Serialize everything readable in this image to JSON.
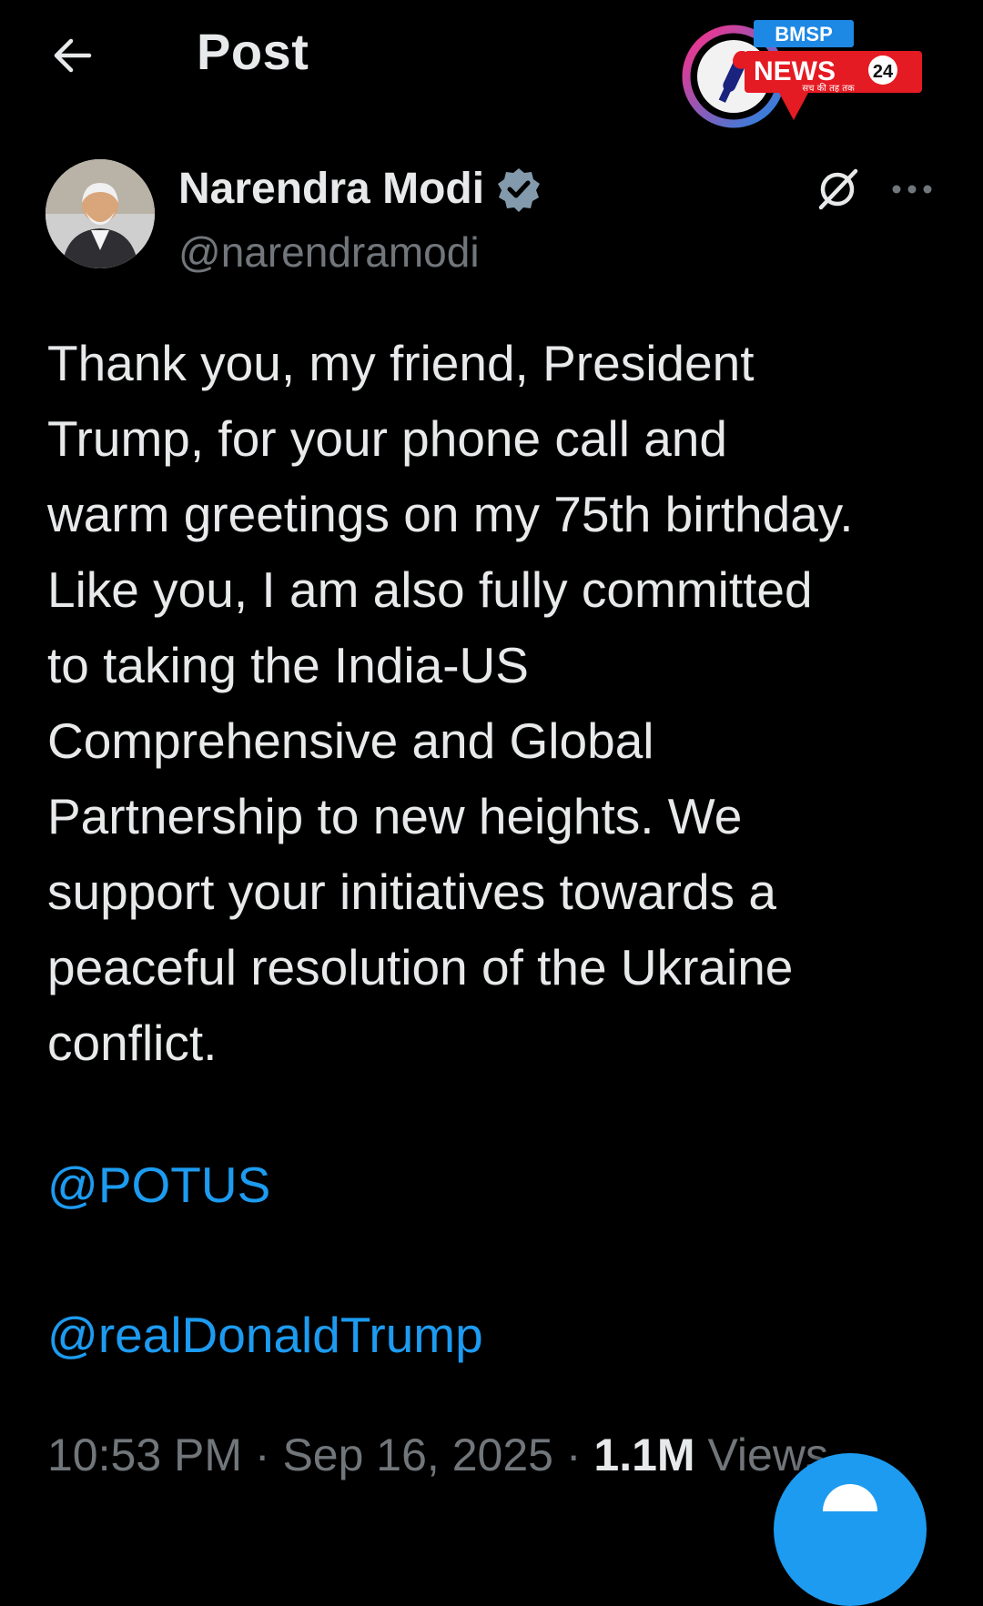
{
  "header": {
    "title": "Post",
    "back_icon": "arrow-left-icon"
  },
  "logo": {
    "top_text": "BMSP",
    "main_text": "NEWS",
    "badge": "24",
    "tagline": "सच की तह तक",
    "colors": {
      "red": "#e51b23",
      "blue": "#1e88e5",
      "pink": "#ff2d87"
    }
  },
  "author": {
    "name": "Narendra Modi",
    "handle": "@narendramodi",
    "verified_icon": "verified-badge-icon"
  },
  "actions": {
    "grok_icon": "grok-icon",
    "more_icon": "more-horizontal-icon"
  },
  "post": {
    "text": "Thank you, my friend, President\nTrump, for your phone call and\nwarm greetings on my 75th birthday.\nLike you, I am also fully committed\nto taking the India-US\nComprehensive and Global\nPartnership to new heights. We\nsupport your initiatives towards a\npeaceful resolution of the Ukraine\nconflict.",
    "mentions": [
      "@POTUS",
      "@realDonaldTrump"
    ]
  },
  "meta": {
    "time": "10:53 PM",
    "separator": " · ",
    "date": "Sep 16, 2025",
    "views_count": "1.1M",
    "views_label": "Views"
  },
  "colors": {
    "background": "#000000",
    "text": "#e7e9ea",
    "secondary": "#71767b",
    "link": "#1d9bf0",
    "verified": "#829aab"
  },
  "fab": {
    "icon": "compose-icon"
  }
}
